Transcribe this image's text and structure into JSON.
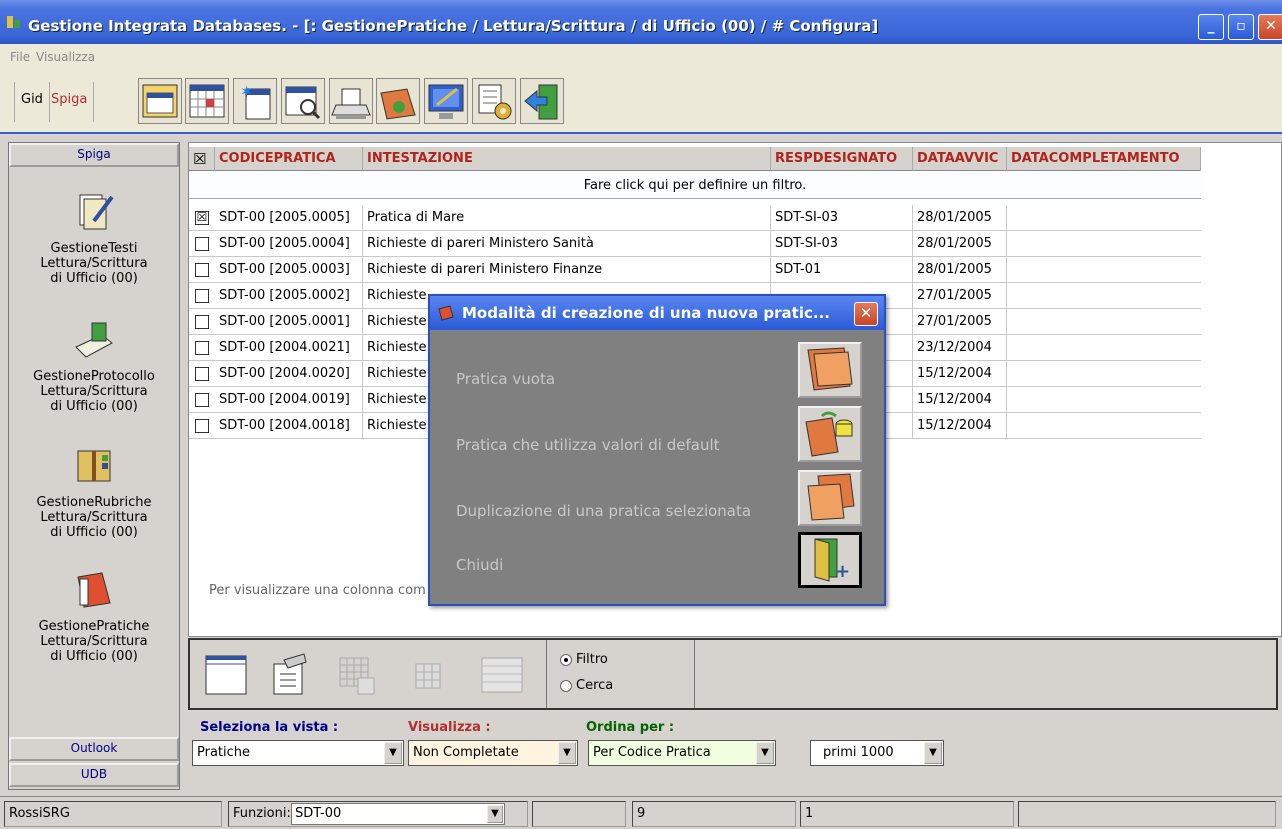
{
  "window": {
    "title": "Gestione Integrata Databases. - [: GestionePratiche / Lettura/Scrittura / di Ufficio (00) / # Configura]",
    "min": "_",
    "max": "▫",
    "close": "✕"
  },
  "menu": {
    "file": "File",
    "visualizza": "Visualizza"
  },
  "toolbar": {
    "tab_gid": "Gid",
    "tab_spiga": "Spiga"
  },
  "sidebar": {
    "header": "Spiga",
    "items": [
      {
        "name": "GestioneTesti",
        "line2": "Lettura/Scrittura",
        "line3": "di Ufficio (00)"
      },
      {
        "name": "GestioneProtocollo",
        "line2": "Lettura/Scrittura",
        "line3": "di Ufficio (00)"
      },
      {
        "name": "GestioneRubriche",
        "line2": "Lettura/Scrittura",
        "line3": "di Ufficio (00)"
      },
      {
        "name": "GestionePratiche",
        "line2": "Lettura/Scrittura",
        "line3": "di Ufficio (00)"
      }
    ],
    "footer_outlook": "Outlook",
    "footer_udb": "UDB"
  },
  "grid": {
    "headers": [
      "CODICEPRATICA",
      "INTESTAZIONE",
      "RESPDESIGNATO",
      "DATAAVVIC",
      "DATACOMPLETAMENTO"
    ],
    "header_check": "☒",
    "filter_text": "Fare click qui per definire un filtro.",
    "rows": [
      {
        "checked": "☒",
        "codice": "SDT-00 [2005.0005]",
        "intestazione": "Pratica di Mare",
        "resp": "SDT-SI-03",
        "data": "28/01/2005"
      },
      {
        "checked": "",
        "codice": "SDT-00 [2005.0004]",
        "intestazione": "Richieste di pareri Ministero Sanità",
        "resp": "SDT-SI-03",
        "data": "28/01/2005"
      },
      {
        "checked": "",
        "codice": "SDT-00 [2005.0003]",
        "intestazione": "Richieste di pareri Ministero Finanze",
        "resp": "SDT-01",
        "data": "28/01/2005"
      },
      {
        "checked": "",
        "codice": "SDT-00 [2005.0002]",
        "intestazione": "Richieste",
        "resp": "",
        "data": "27/01/2005"
      },
      {
        "checked": "",
        "codice": "SDT-00 [2005.0001]",
        "intestazione": "Richieste",
        "resp": "",
        "data": "27/01/2005"
      },
      {
        "checked": "",
        "codice": "SDT-00 [2004.0021]",
        "intestazione": "Richieste",
        "resp": "",
        "data": "23/12/2004"
      },
      {
        "checked": "",
        "codice": "SDT-00 [2004.0020]",
        "intestazione": "Richieste",
        "resp": "",
        "data": "15/12/2004"
      },
      {
        "checked": "",
        "codice": "SDT-00 [2004.0019]",
        "intestazione": "Richieste",
        "resp": "",
        "data": "15/12/2004"
      },
      {
        "checked": "",
        "codice": "SDT-00 [2004.0018]",
        "intestazione": "Richieste",
        "resp": "",
        "data": "15/12/2004"
      }
    ],
    "hint": "Per visualizzare una colonna com"
  },
  "options": {
    "filtro": "Filtro",
    "cerca": "Cerca"
  },
  "selection": {
    "vista_label": "Seleziona la vista :",
    "vista_value": "Pratiche",
    "visualizza_label": "Visualizza :",
    "visualizza_value": "Non Completate",
    "ordina_label": "Ordina per :",
    "ordina_value": "Per Codice Pratica",
    "limit_value": "primi 1000",
    "arrow": "▼"
  },
  "status": {
    "user": "RossiSRG",
    "funzioni_label": "Funzioni:",
    "funzioni_value": "SDT-00",
    "count": "9",
    "page": "1"
  },
  "dialog": {
    "title": "Modalità di creazione di una nuova pratic...",
    "close": "✕",
    "options": [
      "Pratica vuota",
      "Pratica che utilizza valori di default",
      "Duplicazione di una pratica selezionata",
      "Chiudi"
    ]
  },
  "colors": {
    "titlebar": "#3a66d8",
    "header_text": "#b0241a",
    "vista_label": "#00008b",
    "visualizza_label": "#b03030",
    "ordina_label": "#006400",
    "dialog_bg": "#808080"
  }
}
